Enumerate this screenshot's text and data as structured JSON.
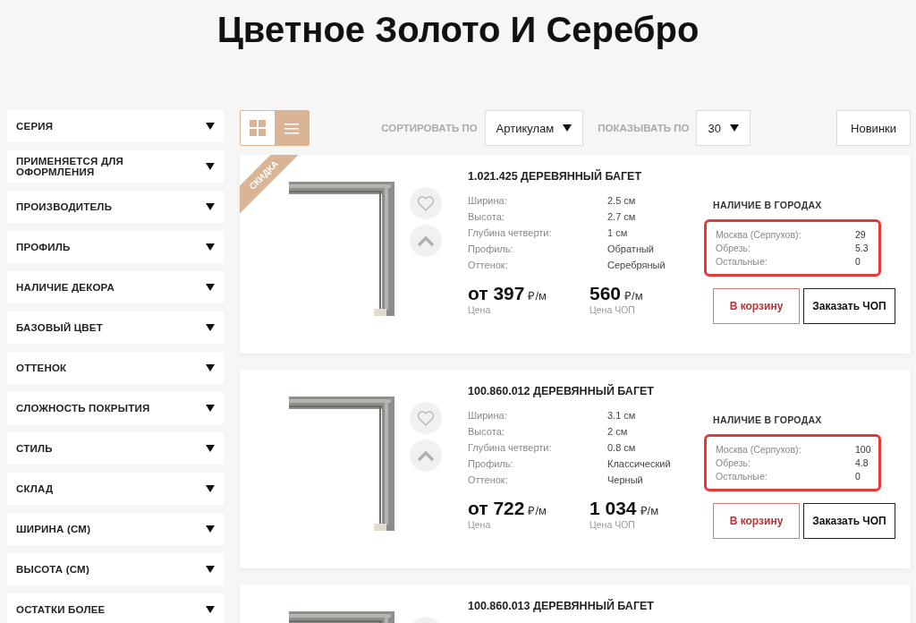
{
  "page_title": "Цветное Золото И Серебро",
  "filters": [
    {
      "label": "СЕРИЯ"
    },
    {
      "label": "ПРИМЕНЯЕТСЯ ДЛЯ ОФОРМЛЕНИЯ"
    },
    {
      "label": "ПРОИЗВОДИТЕЛЬ"
    },
    {
      "label": "ПРОФИЛЬ"
    },
    {
      "label": "НАЛИЧИЕ ДЕКОРА"
    },
    {
      "label": "БАЗОВЫЙ ЦВЕТ"
    },
    {
      "label": "ОТТЕНОК"
    },
    {
      "label": "СЛОЖНОСТЬ ПОКРЫТИЯ"
    },
    {
      "label": "СТИЛЬ"
    },
    {
      "label": "СКЛАД"
    },
    {
      "label": "ШИРИНА (СМ)"
    },
    {
      "label": "ВЫСОТА (СМ)"
    },
    {
      "label": "ОСТАТКИ БОЛЕЕ"
    }
  ],
  "toolbar": {
    "views": [
      {
        "kind": "grid",
        "selected": true
      },
      {
        "kind": "list",
        "selected": false
      }
    ],
    "sort": {
      "label": "СОРТИРОВАТЬ ПО",
      "value": "Артикулам"
    },
    "per_page": {
      "label": "ПОКАЗЫВАТЬ ПО",
      "value": "30"
    },
    "new_button": "Новинки"
  },
  "products": [
    {
      "badge": "СКИДКА",
      "title": "1.021.425 ДЕРЕВЯННЫЙ БАГЕТ",
      "specs": [
        {
          "label": "Ширина:",
          "value": "2.5 см"
        },
        {
          "label": "Высота:",
          "value": "2.7 см"
        },
        {
          "label": "Глубина четверти:",
          "value": "1 см"
        },
        {
          "label": "Профиль:",
          "value": "Обратный"
        },
        {
          "label": "Оттенок:",
          "value": "Серебряный"
        }
      ],
      "prices": [
        {
          "amount": "от 397",
          "unit": "₽/м",
          "label": "Цена"
        },
        {
          "amount": "560",
          "unit": "₽/м",
          "label": "Цена ЧОП"
        }
      ],
      "stock": {
        "title": "НАЛИЧИЕ В ГОРОДАХ",
        "highlighted": true,
        "rows": [
          {
            "label": "Москва (Серпухов):",
            "value": "29"
          },
          {
            "label": "Обрезь:",
            "value": "5.3"
          },
          {
            "label": "Остальные:",
            "value": "0"
          }
        ]
      },
      "buttons": {
        "cart": "В корзину",
        "order": "Заказать ЧОП"
      }
    },
    {
      "title": "100.860.012 ДЕРЕВЯННЫЙ БАГЕТ",
      "specs": [
        {
          "label": "Ширина:",
          "value": "3.1 см"
        },
        {
          "label": "Высота:",
          "value": "2 см"
        },
        {
          "label": "Глубина четверти:",
          "value": "0.8 см"
        },
        {
          "label": "Профиль:",
          "value": "Классический"
        },
        {
          "label": "Оттенок:",
          "value": "Черный"
        }
      ],
      "prices": [
        {
          "amount": "от 722",
          "unit": "₽/м",
          "label": "Цена"
        },
        {
          "amount": "1 034",
          "unit": "₽/м",
          "label": "Цена ЧОП"
        }
      ],
      "stock": {
        "title": "НАЛИЧИЕ В ГОРОДАХ",
        "highlighted": true,
        "rows": [
          {
            "label": "Москва (Серпухов):",
            "value": "100"
          },
          {
            "label": "Обрезь:",
            "value": "4.8"
          },
          {
            "label": "Остальные:",
            "value": "0"
          }
        ]
      },
      "buttons": {
        "cart": "В корзину",
        "order": "Заказать ЧОП"
      }
    },
    {
      "title": "100.860.013 ДЕРЕВЯННЫЙ БАГЕТ"
    }
  ]
}
